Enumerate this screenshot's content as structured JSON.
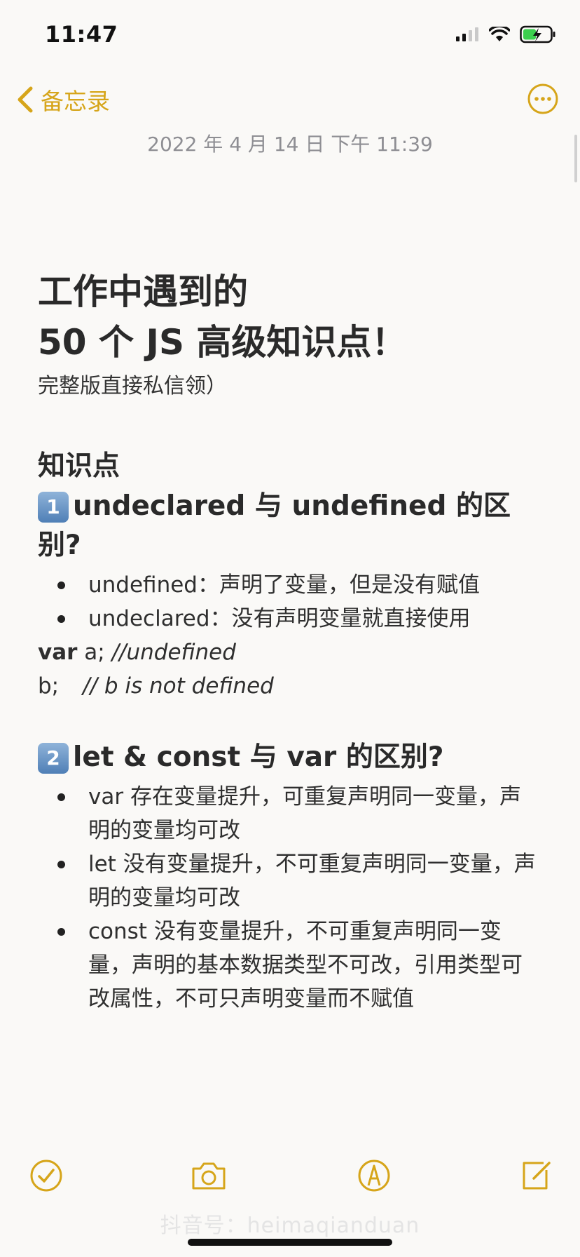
{
  "status_bar": {
    "time": "11:47"
  },
  "nav": {
    "back_label": "备忘录",
    "more_icon": "ellipsis-circle-icon"
  },
  "note": {
    "date": "2022 年 4 月 14 日  下午 11:39",
    "title_line1": "工作中遇到的",
    "title_line2": "50 个 JS 高级知识点！",
    "subtitle": "完整版直接私信领）",
    "section_label": "知识点",
    "section1": {
      "badge": "1",
      "heading": "undeclared 与 undefined 的区别?",
      "bullets": [
        "undefined：声明了变量，但是没有赋值",
        "undeclared：没有声明变量就直接使用"
      ],
      "code": {
        "line1_keyword": "var",
        "line1_code": " a; ",
        "line1_comment": "//undefined",
        "line2_code": "b;",
        "line2_comment": "// b is not defined"
      }
    },
    "section2": {
      "badge": "2",
      "heading": "let & const 与 var 的区别?",
      "bullets": [
        "var 存在变量提升，可重复声明同一变量，声明的变量均可改",
        "let 没有变量提升，不可重复声明同一变量，声明的变量均可改",
        "const 没有变量提升，不可重复声明同一变量，声明的基本数据类型不可改，引用类型可改属性，不可只声明变量而不赋值"
      ]
    }
  },
  "toolbar": {
    "checklist_icon": "checkmark-circle-icon",
    "camera_icon": "camera-icon",
    "markup_icon": "pen-circle-icon",
    "compose_icon": "compose-icon"
  },
  "watermark": "抖音号：heimaqianduan",
  "colors": {
    "accent": "#d6a51a",
    "background": "#faf9f7",
    "date_text": "#8e8e93"
  }
}
